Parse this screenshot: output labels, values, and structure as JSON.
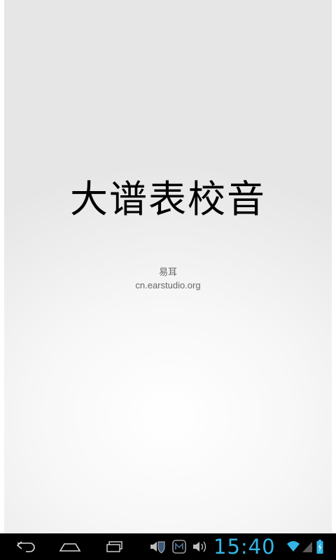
{
  "app": {
    "title": "大谱表校音",
    "publisher": "易耳",
    "website": "cn.earstudio.org"
  },
  "system_bar": {
    "clock": "15:40",
    "nav_icons": [
      "back-icon",
      "home-icon",
      "recent-apps-icon"
    ],
    "status_icons": [
      "volume-shield-icon",
      "maxthon-icon",
      "volume-icon",
      "wifi-icon",
      "signal-icon",
      "battery-charging-icon"
    ],
    "accent_color": "#33b5e5"
  }
}
